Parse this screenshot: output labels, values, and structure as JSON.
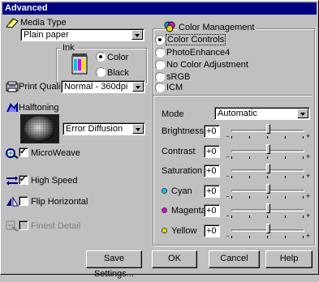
{
  "window": {
    "title": "Advanced"
  },
  "media_type": {
    "label": "Media Type",
    "value": "Plain paper"
  },
  "ink": {
    "label": "Ink",
    "options": [
      "Color",
      "Black"
    ],
    "selected": "Color"
  },
  "print_quality": {
    "label": "Print Quality",
    "value": "Normal - 360dpi"
  },
  "halftoning": {
    "label": "Halftoning",
    "value": "Error Diffusion"
  },
  "options": {
    "microweave": {
      "label": "MicroWeave",
      "checked": true
    },
    "high_speed": {
      "label": "High Speed",
      "checked": true
    },
    "flip_horizontal": {
      "label": "Flip Horizontal",
      "checked": false
    },
    "finest_detail": {
      "label": "Finest Detail",
      "checked": false,
      "enabled": false
    }
  },
  "color_management": {
    "label": "Color Management",
    "options": [
      "Color Controls",
      "PhotoEnhance4",
      "No Color Adjustment",
      "sRGB",
      "ICM"
    ],
    "selected": "Color Controls",
    "mode": {
      "label": "Mode",
      "value": "Automatic"
    },
    "sliders": [
      {
        "name": "Brightness",
        "value": "+0",
        "level": 0.5,
        "dot": null
      },
      {
        "name": "Contrast",
        "value": "+0",
        "level": 0.5,
        "dot": null
      },
      {
        "name": "Saturation",
        "value": "+0",
        "level": 0.5,
        "dot": null
      },
      {
        "name": "Cyan",
        "value": "+0",
        "level": 0.5,
        "dot": "#00c8ff"
      },
      {
        "name": "Magenta",
        "value": "+0",
        "level": 0.5,
        "dot": "#e000e0"
      },
      {
        "name": "Yellow",
        "value": "+0",
        "level": 0.5,
        "dot": "#f0e000"
      }
    ],
    "slider_minus": "-",
    "slider_plus": "+"
  },
  "buttons": {
    "save": "Save Settings...",
    "ok": "OK",
    "cancel": "Cancel",
    "help": "Help"
  },
  "colors": {
    "title_bar": "#000080",
    "face": "#c0c0c0"
  }
}
